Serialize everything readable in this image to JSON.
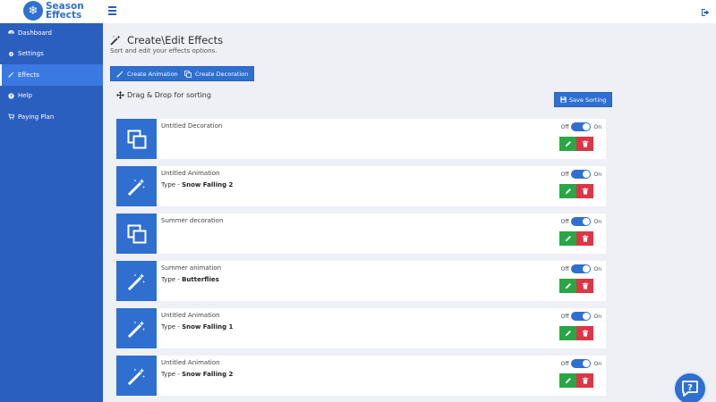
{
  "app": {
    "logo_line1": "Season",
    "logo_line2": "Effects"
  },
  "sidebar": {
    "items": [
      {
        "label": "Dashboard",
        "icon": "dashboard-icon",
        "active": false
      },
      {
        "label": "Settings",
        "icon": "gear-icon",
        "active": false
      },
      {
        "label": "Effects",
        "icon": "magic-wand-icon",
        "active": true
      },
      {
        "label": "Help",
        "icon": "question-circle-icon",
        "active": false
      },
      {
        "label": "Paying Plan",
        "icon": "cart-icon",
        "active": false
      }
    ]
  },
  "main": {
    "title": "Create\\Edit Effects",
    "subtitle": "Sort and edit your effects options.",
    "create_animation_label": "Create Animation",
    "create_decoration_label": "Create Decoration",
    "drag_drop_label": "Drag & Drop for sorting",
    "save_sorting_label": "Save Sorting"
  },
  "toggle": {
    "off_label": "Off",
    "on_label": "On"
  },
  "effects": [
    {
      "kind": "decoration",
      "title": "Untitled Decoration",
      "type_prefix": "",
      "type_value": "",
      "enabled": true
    },
    {
      "kind": "animation",
      "title": "Untitled Animation",
      "type_prefix": "Type - ",
      "type_value": "Snow Falling 2",
      "enabled": true
    },
    {
      "kind": "decoration",
      "title": "Summer decoration",
      "type_prefix": "",
      "type_value": "",
      "enabled": true
    },
    {
      "kind": "animation",
      "title": "Summer animation",
      "type_prefix": "Type - ",
      "type_value": "Butterflies",
      "enabled": true
    },
    {
      "kind": "animation",
      "title": "Untitled Animation",
      "type_prefix": "Type - ",
      "type_value": "Snow Falling 1",
      "enabled": true
    },
    {
      "kind": "animation",
      "title": "Untitled Animation",
      "type_prefix": "Type - ",
      "type_value": "Snow Falling 2",
      "enabled": true
    }
  ],
  "colors": {
    "primary": "#2f6fd0",
    "sidebar": "#2b5fbf",
    "sidebar_active": "#3a79e2",
    "edit": "#28a745",
    "delete": "#dc3545",
    "background": "#eef0f6"
  }
}
